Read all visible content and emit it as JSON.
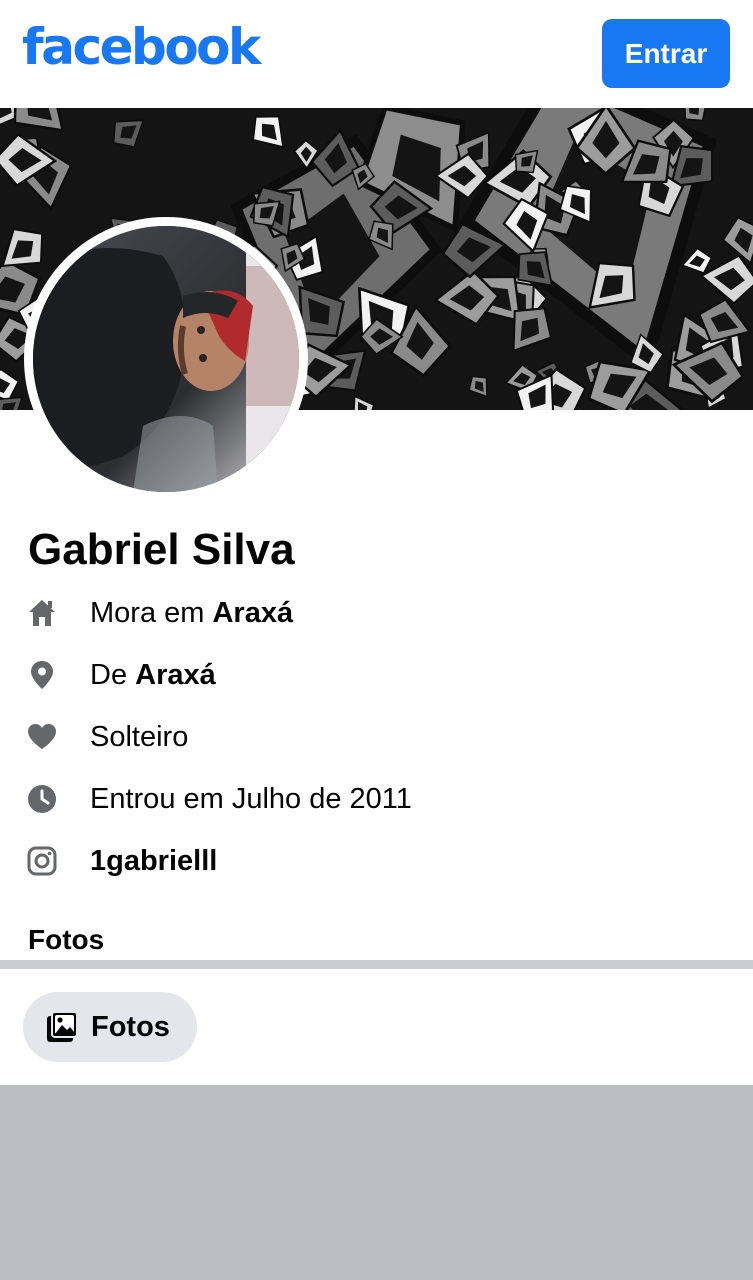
{
  "header": {
    "logo_text": "facebook",
    "login_label": "Entrar",
    "brand_color": "#1877f2"
  },
  "profile": {
    "name": "Gabriel Silva",
    "details": [
      {
        "icon": "home-icon",
        "prefix": "Mora em ",
        "value": "Araxá"
      },
      {
        "icon": "location-pin-icon",
        "prefix": "De ",
        "value": "Araxá"
      },
      {
        "icon": "heart-icon",
        "prefix": "Solteiro",
        "value": ""
      },
      {
        "icon": "clock-icon",
        "prefix": "Entrou em Julho de 2011",
        "value": ""
      },
      {
        "icon": "instagram-icon",
        "prefix": "",
        "value": "1gabrielll"
      }
    ]
  },
  "photos": {
    "heading": "Fotos",
    "chip_label": "Fotos",
    "chip_icon": "photos-icon"
  }
}
